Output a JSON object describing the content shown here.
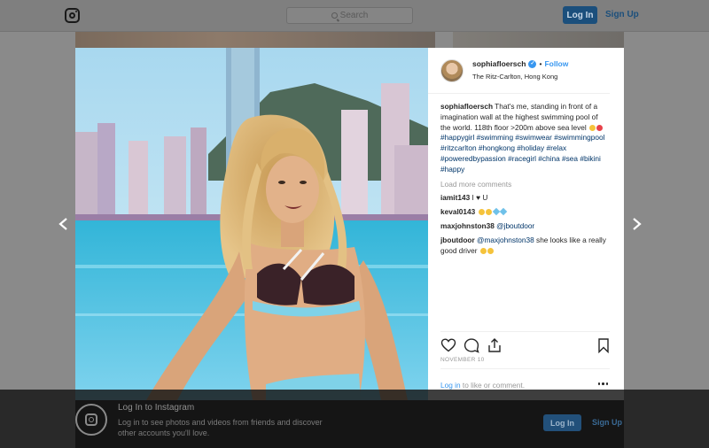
{
  "topbar": {
    "search_placeholder": "Search",
    "login_label": "Log In",
    "signup_label": "Sign Up"
  },
  "post": {
    "username": "sophiafloersch",
    "follow_label": "Follow",
    "separator": "•",
    "location": "The Ritz-Carlton, Hong Kong",
    "caption_user": "sophiafloersch",
    "caption_text": "That's me, standing in front of a imagination wall at the highest swimming pool of the world. 118th floor >200m above sea level",
    "hashtags": [
      "#happygirl",
      "#swimming",
      "#swimwear",
      "#swimmingpool",
      "#ritzcarlton",
      "#hongkong",
      "#holiday",
      "#relax",
      "#poweredbypassion",
      "#racegirl",
      "#china",
      "#sea",
      "#bikini",
      "#happy"
    ],
    "load_more": "Load more comments",
    "comments": [
      {
        "user": "iamit143",
        "text": "I ♥ U"
      },
      {
        "user": "keval0143",
        "text": ""
      },
      {
        "user": "maxjohnston38",
        "mention": "@jboutdoor",
        "text": ""
      },
      {
        "user": "jboutdoor",
        "mention": "@maxjohnston38",
        "text": "she looks like a really good driver"
      }
    ],
    "date": "NOVEMBER 10",
    "login_link": "Log in",
    "login_suffix": " to like or comment."
  },
  "banner": {
    "title": "Log In to Instagram",
    "text": "Log in to see photos and videos from friends and discover other accounts you'll love.",
    "login_label": "Log In",
    "signup_label": "Sign Up"
  },
  "colors": {
    "link_blue": "#3897f0",
    "hashtag": "#003569",
    "muted": "#999999"
  }
}
